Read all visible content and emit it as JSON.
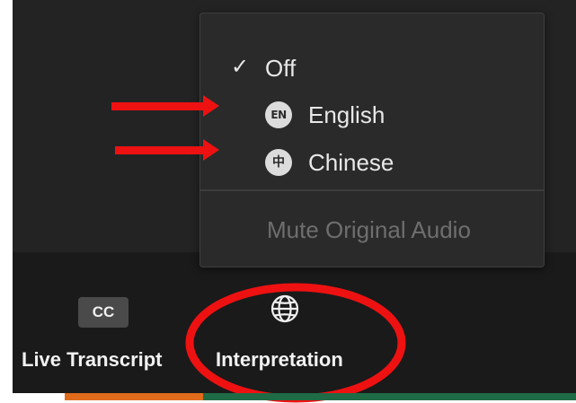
{
  "interpretation_menu": {
    "items": [
      {
        "check": "✓",
        "label": "Off",
        "selected": true
      },
      {
        "badge": "EN",
        "label": "English"
      },
      {
        "badge": "中",
        "label": "Chinese"
      }
    ],
    "mute_label": "Mute Original Audio"
  },
  "toolbar": {
    "live_transcript": {
      "icon_text": "CC",
      "label": "Live Transcript"
    },
    "interpretation": {
      "icon": "globe-icon",
      "label": "Interpretation"
    }
  },
  "annotations": {
    "arrow_color": "#ee1111",
    "highlight_color": "#ee1111"
  },
  "colors": {
    "background": "#232323",
    "menu_background": "#2a2a2a",
    "menu_text": "#e8e8e8",
    "disabled_text": "#6e6e6e",
    "footer_orange": "#e06b1b",
    "footer_green": "#1f6b45"
  }
}
